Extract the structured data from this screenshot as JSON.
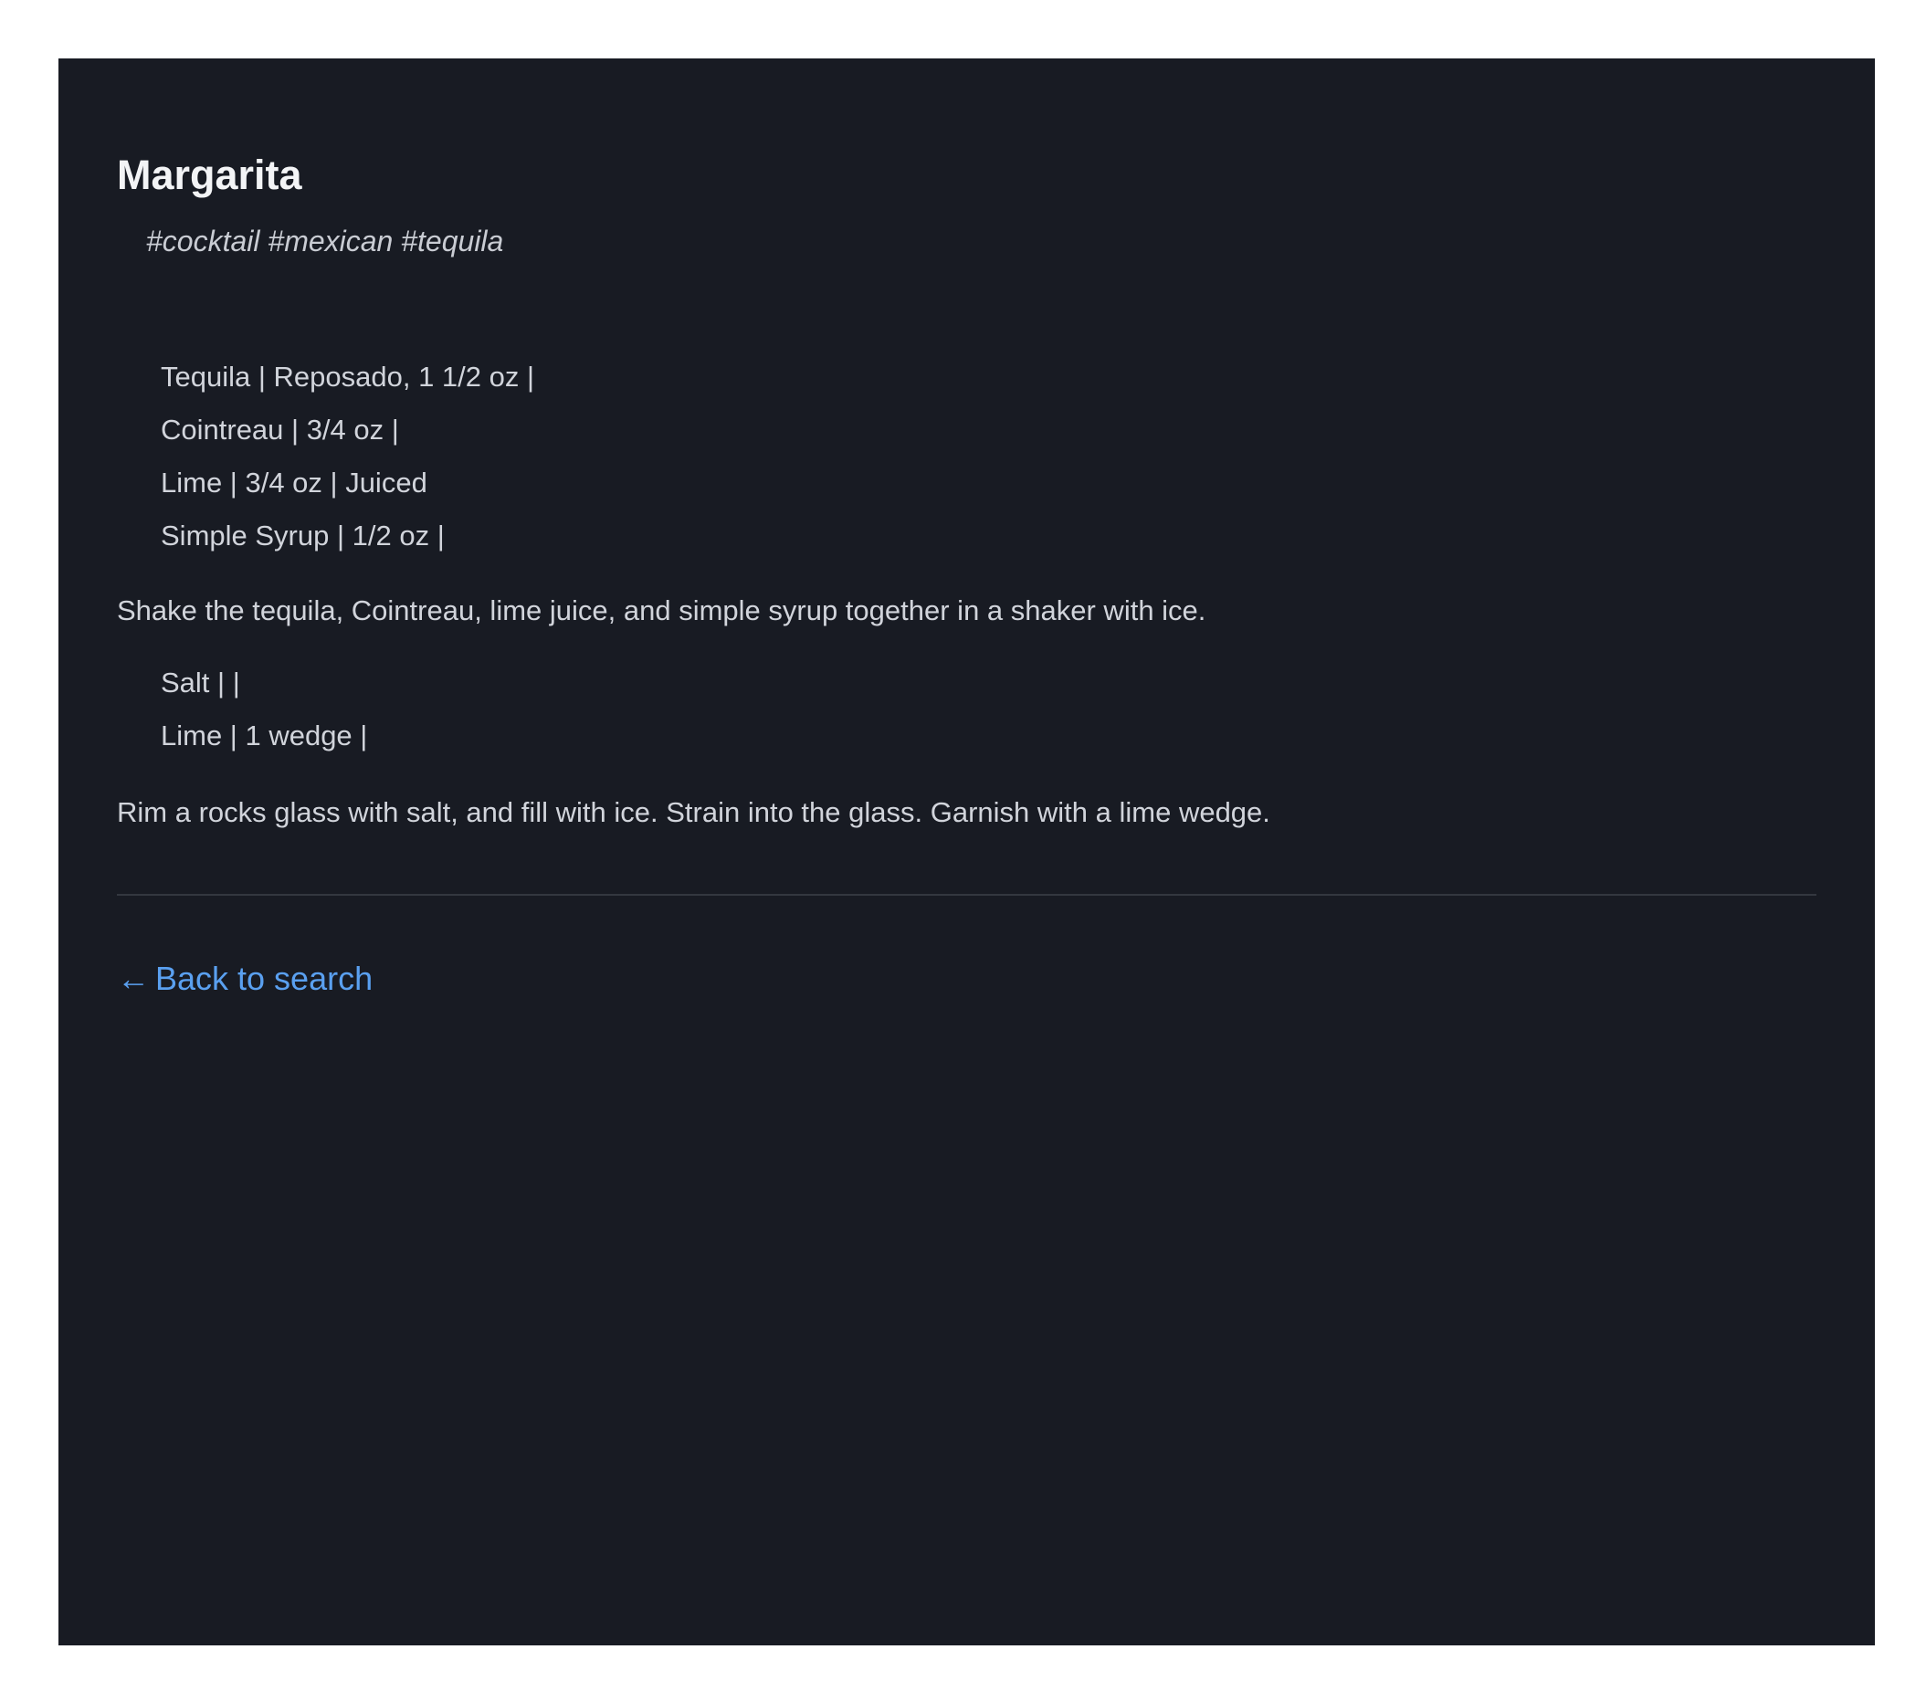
{
  "recipe": {
    "title": "Margarita",
    "tags": "#cocktail #mexican #tequila",
    "ingredient_groups": [
      [
        "Tequila | Reposado, 1 1/2 oz |",
        "Cointreau | 3/4 oz |",
        "Lime | 3/4 oz | Juiced",
        "Simple Syrup | 1/2 oz |"
      ],
      [
        "Salt | |",
        "Lime | 1 wedge |"
      ]
    ],
    "steps": [
      "Shake the tequila, Cointreau, lime juice, and simple syrup together in a shaker with ice.",
      "Rim a rocks glass with salt, and fill with ice. Strain into the glass. Garnish with a lime wedge."
    ]
  },
  "nav": {
    "back_arrow": "←",
    "back_label": "Back to search"
  },
  "colors": {
    "background": "#181b23",
    "text": "#d1d4db",
    "title": "#f3f4f6",
    "link": "#5aa0f0",
    "divider": "#33373f"
  }
}
